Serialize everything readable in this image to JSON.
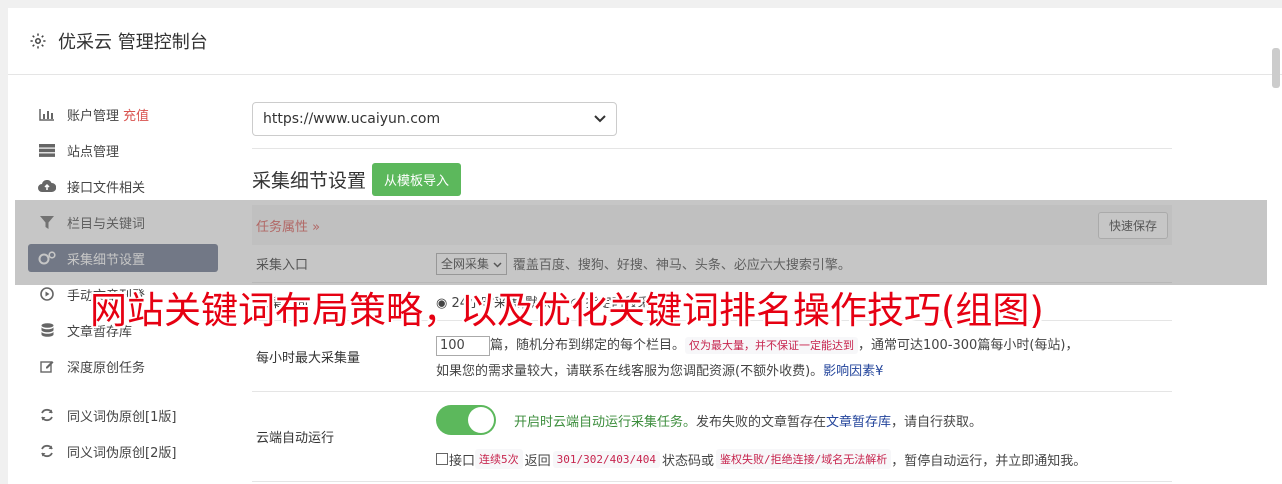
{
  "header": {
    "title": "优采云 管理控制台",
    "icon": "gear-icon"
  },
  "sidebar": {
    "items": [
      {
        "label": "账户管理",
        "badge": "充值",
        "icon": "bar-chart-icon"
      },
      {
        "label": "站点管理",
        "icon": "server-icon"
      },
      {
        "label": "接口文件相关",
        "icon": "cloud-upload-icon"
      },
      {
        "label": "栏目与关键词",
        "icon": "filter-icon"
      },
      {
        "label": "采集细节设置",
        "icon": "gears-icon",
        "active": true
      },
      {
        "label": "手动文章刊登",
        "icon": "play-circle-icon"
      },
      {
        "label": "文章暂存库",
        "icon": "database-icon"
      },
      {
        "label": "深度原创任务",
        "icon": "edit-icon"
      },
      {
        "label": "同义词伪原创[1版]",
        "icon": "refresh-icon"
      },
      {
        "label": "同义词伪原创[2版]",
        "icon": "refresh-icon"
      }
    ]
  },
  "main": {
    "site_select": "https://www.ucaiyun.com",
    "section_title": "采集细节设置",
    "import_button": "从模板导入",
    "task_attr": "任务属性",
    "quick_save": "快速保存",
    "rows": {
      "entry": {
        "label": "采集入口",
        "select": "全网采集",
        "desc": "覆盖百度、搜狗、好搜、神马、头条、必应六大搜索引擎。"
      },
      "time": {
        "label": "采集时间",
        "opt1": "24小时采集(默认)",
        "opt2": "指定时段采集"
      },
      "max": {
        "label": "每小时最大采集量",
        "value": "100",
        "text1": "篇，随机分布到绑定的每个栏目。",
        "code1": "仅为最大量，并不保证一定能达到",
        "text2": "，通常可达100-300篇每小时(每站)，",
        "text3": "如果您的需求量较大，请联系在线客服为您调配资源(不额外收费)。",
        "link": "影响因素"
      },
      "cloud": {
        "label": "云端自动运行",
        "green": "开启时云端自动运行采集任务。",
        "text1": "发布失败的文章暂存在",
        "link": "文章暂存库",
        "text2": "，请自行获取。",
        "cb_label": "接口",
        "code1": "连续5次",
        "text3": "返回",
        "code2": "301/302/403/404",
        "text4": "状态码或",
        "code3": "鉴权失败/拒绝连接/域名无法解析",
        "text5": "，暂停自动运行，并立即通知我。"
      }
    }
  },
  "overlay": {
    "headline": "网站关键词布局策略，以及优化关键词排名操作技巧(组图)"
  },
  "colors": {
    "accent_green": "#5cb85c",
    "active_nav": "#66728a",
    "headline_red": "#e60012",
    "badge_red": "#d9534f"
  }
}
